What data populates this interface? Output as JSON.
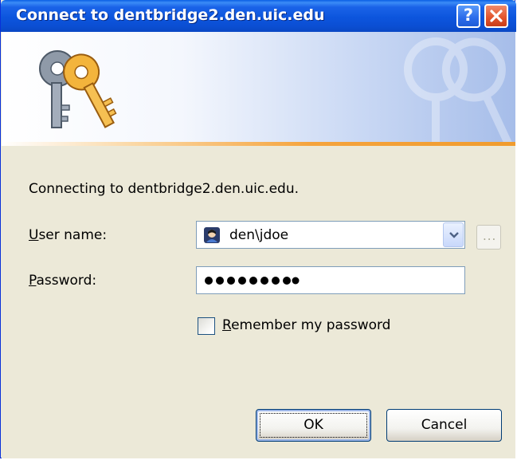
{
  "window": {
    "title": "Connect to dentbridge2.den.uic.edu",
    "help_label": "?",
    "colors": {
      "titlebar": "#0b4fd4",
      "close": "#e2532a",
      "accent_stripe": "#f5a43d",
      "face": "#ece9d8"
    }
  },
  "dialog": {
    "connecting_text": "Connecting to dentbridge2.den.uic.edu.",
    "username": {
      "label_accel": "U",
      "label_rest": "ser name:",
      "value": "den\\jdoe"
    },
    "browse_label": "...",
    "password": {
      "label_accel": "P",
      "label_rest": "assword:",
      "masked_value": "•••••••••"
    },
    "remember": {
      "label_accel": "R",
      "label_rest": "emember my password",
      "checked": false
    },
    "buttons": {
      "ok": "OK",
      "cancel": "Cancel"
    }
  },
  "icons": [
    "keys-icon",
    "help-icon",
    "close-icon",
    "user-avatar-icon",
    "dropdown-arrow-icon"
  ]
}
